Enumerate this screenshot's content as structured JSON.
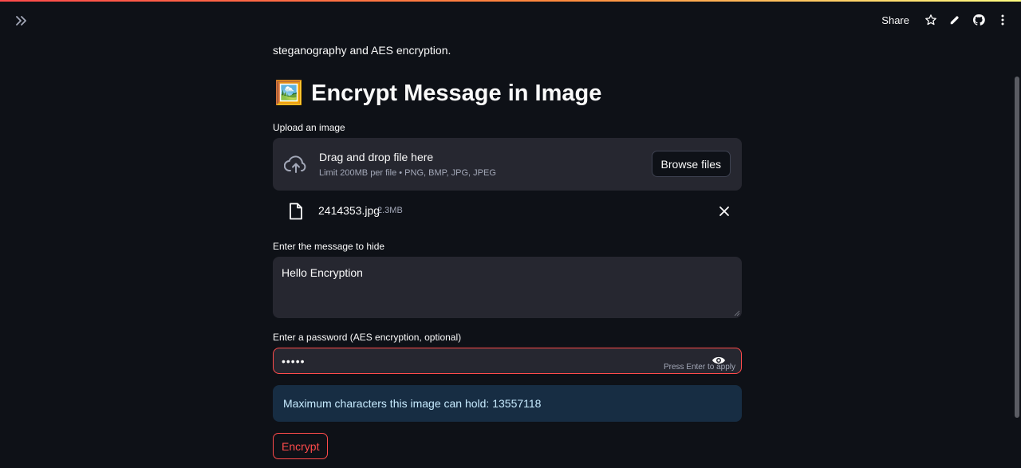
{
  "header": {
    "share_label": "Share",
    "icons": [
      "expand-sidebar-icon",
      "star-icon",
      "edit-icon",
      "github-icon",
      "more-vertical-icon"
    ]
  },
  "intro_text": "steganography and AES encryption.",
  "page": {
    "title_icon": "🖼️",
    "title": "Encrypt Message in Image"
  },
  "upload": {
    "label": "Upload an image",
    "drop_title": "Drag and drop file here",
    "drop_subtitle": "Limit 200MB per file • PNG, BMP, JPG, JPEG",
    "browse_label": "Browse files",
    "file": {
      "name": "2414353.jpg",
      "size": "2.3MB"
    }
  },
  "message": {
    "label": "Enter the message to hide",
    "value": "Hello Encryption"
  },
  "password": {
    "label": "Enter a password (AES encryption, optional)",
    "masked_value": "•••••",
    "hint": "Press Enter to apply"
  },
  "info": {
    "text": "Maximum characters this image can hold: 13557118"
  },
  "actions": {
    "encrypt_label": "Encrypt"
  },
  "colors": {
    "background": "#0e1117",
    "input_bg": "#262730",
    "accent_red": "#ff4b4b",
    "info_bg": "#172d43",
    "info_text": "#c7ebff"
  }
}
